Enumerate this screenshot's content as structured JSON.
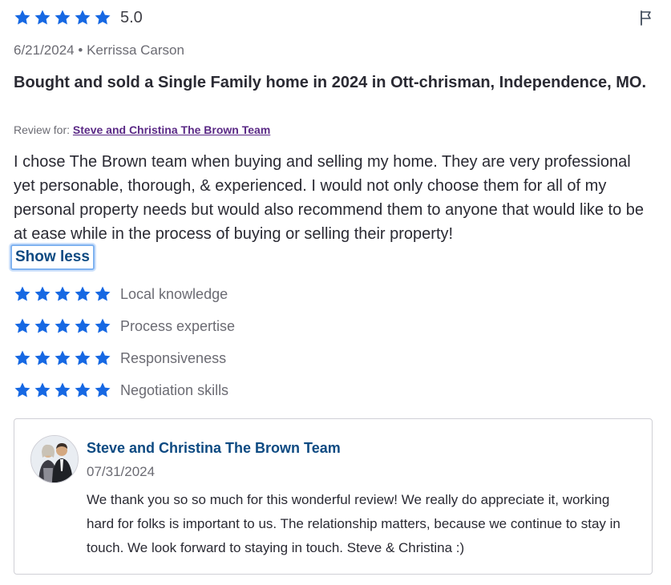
{
  "colors": {
    "star": "#1668e3",
    "link": "#5b2a86",
    "accent": "#0d4a82"
  },
  "review": {
    "rating": "5.0",
    "stars": 5,
    "date": "6/21/2024",
    "separator": "•",
    "author": "Kerrissa Carson",
    "title": "Bought and sold a Single Family home in 2024 in Ott-chrisman, Independence, MO.",
    "review_for_label": "Review for:",
    "review_for_link": "Steve and Christina The Brown Team",
    "body": "I chose The Brown team when buying and selling my home. They are very professional yet personable, thorough, & experienced. I would not only choose them for all of my personal property needs but would also recommend them to anyone that would like to be at ease while in the process of buying or selling their property!",
    "show_less_label": "Show less",
    "flag_icon": "flag-icon"
  },
  "sub_ratings": [
    {
      "label": "Local knowledge",
      "stars": 5
    },
    {
      "label": "Process expertise",
      "stars": 5
    },
    {
      "label": "Responsiveness",
      "stars": 5
    },
    {
      "label": "Negotiation skills",
      "stars": 5
    }
  ],
  "response": {
    "team_name": "Steve and Christina The Brown Team",
    "date": "07/31/2024",
    "text": "We thank you so so much for this wonderful review! We really do appreciate it, working hard for folks is important to us. The relationship matters, because we continue to stay in touch. We look forward to staying in touch. Steve & Christina :)"
  }
}
